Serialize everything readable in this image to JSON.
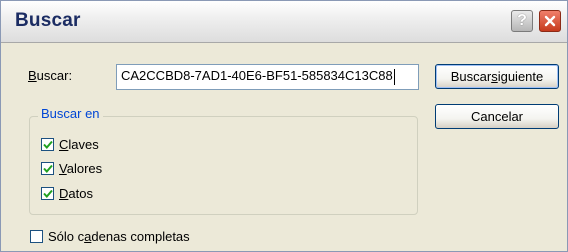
{
  "window": {
    "title": "Buscar"
  },
  "search": {
    "label_underlined": "B",
    "label_rest": "uscar:",
    "value": "CA2CCBD8-7AD1-40E6-BF51-585834C13C88"
  },
  "buttons": {
    "find_next_pre": "Buscar ",
    "find_next_underlined": "s",
    "find_next_post": "iguiente",
    "cancel": "Cancelar"
  },
  "group": {
    "title": "Buscar en",
    "options": [
      {
        "underlined": "C",
        "rest": "laves",
        "checked": true
      },
      {
        "underlined": "V",
        "rest": "alores",
        "checked": true
      },
      {
        "underlined": "D",
        "rest": "atos",
        "checked": true
      }
    ]
  },
  "whole_string": {
    "pre": "Sólo c",
    "underlined": "a",
    "post": "denas completas",
    "checked": false
  },
  "colors": {
    "title_text": "#1b2c63",
    "group_title": "#0046d5",
    "check_mark": "#21a121",
    "close_button": "#c63a1d"
  },
  "icons": {
    "help": "question-mark",
    "close": "x"
  }
}
